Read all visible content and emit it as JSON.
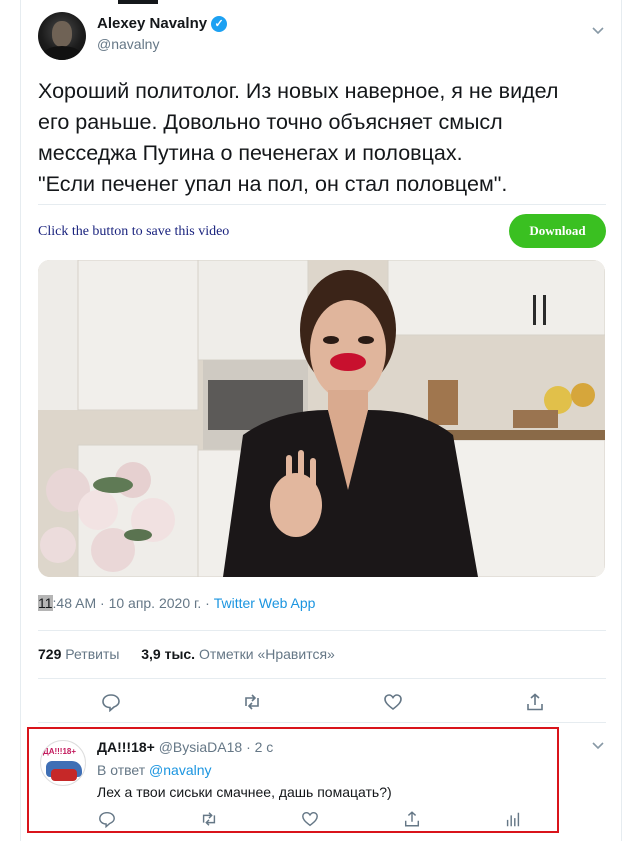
{
  "tweet": {
    "author_name": "Alexey Navalny",
    "author_handle": "@navalny",
    "verified_icon": "verified-badge-icon",
    "text_lines": [
      "Хороший политолог. Из новых наверное, я не видел",
      "его раньше. Довольно точно объясняет смысл",
      "месседжа Путина о печенегах и половцах.",
      "\"Если печенег упал на пол, он стал половцем\"."
    ],
    "time_highlight": "11",
    "time_rest": ":48 AM · 10 апр. 2020 г. · ",
    "source_app": "Twitter Web App",
    "retweet_count": "729",
    "retweet_label": "Ретвиты",
    "like_count": "3,9 тыс.",
    "like_label": "Отметки «Нравится»"
  },
  "promo": {
    "text": "Click the button to save this video",
    "button_label": "Download",
    "button_color": "#3ac021"
  },
  "actions": [
    "reply-icon",
    "retweet-icon",
    "like-icon",
    "share-icon"
  ],
  "reply": {
    "author_name": "ДА!!!18+",
    "author_handle": "@BysiaDA18",
    "time": "· 2 с",
    "reply_to_prefix": "В ответ",
    "reply_to_mention": "@navalny",
    "text": "Лех а твои сиськи  смачнее, дашь помацать?)",
    "avatar_text": "ДА!!!18+",
    "highlight_color": "#d9141b",
    "actions": [
      "reply-icon",
      "retweet-icon",
      "like-icon",
      "share-icon",
      "analytics-icon"
    ]
  },
  "colors": {
    "link": "#1b95e0",
    "muted": "#657786",
    "text": "#14171a"
  }
}
